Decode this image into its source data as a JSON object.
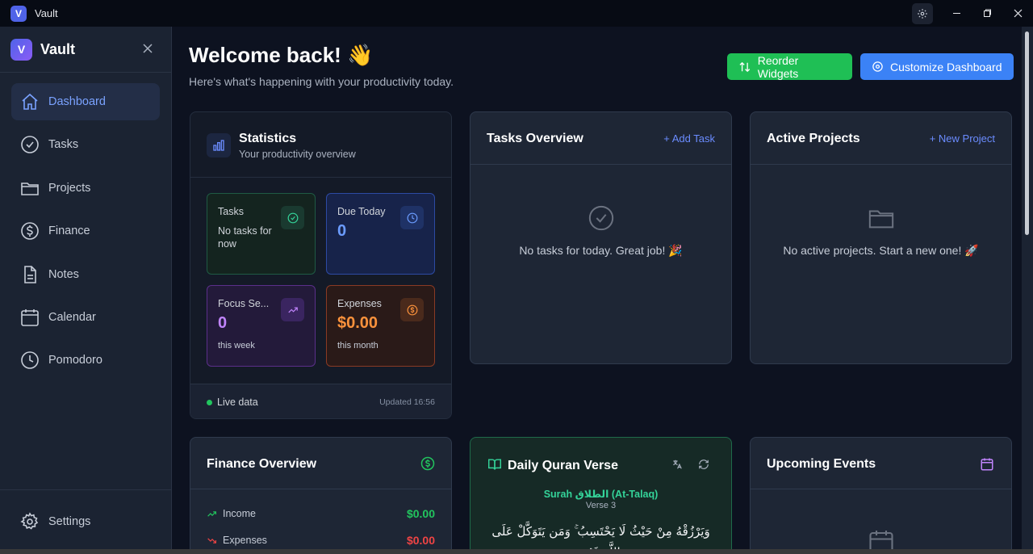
{
  "window": {
    "title": "Vault",
    "logo_letter": "V"
  },
  "sidebar": {
    "brand": "Vault",
    "logo_letter": "V",
    "items": [
      {
        "label": "Dashboard",
        "icon": "home-icon",
        "active": true
      },
      {
        "label": "Tasks",
        "icon": "check-circle-icon"
      },
      {
        "label": "Projects",
        "icon": "folder-icon"
      },
      {
        "label": "Finance",
        "icon": "dollar-circle-icon"
      },
      {
        "label": "Notes",
        "icon": "file-icon"
      },
      {
        "label": "Calendar",
        "icon": "calendar-icon"
      },
      {
        "label": "Pomodoro",
        "icon": "clock-icon"
      }
    ],
    "settings_label": "Settings"
  },
  "header": {
    "title": "Welcome back! 👋",
    "subtitle": "Here's what's happening with your productivity today.",
    "reorder_label": "Reorder Widgets",
    "customize_label": "Customize Dashboard"
  },
  "statistics": {
    "title": "Statistics",
    "subtitle": "Your productivity overview",
    "tiles": {
      "tasks": {
        "label": "Tasks",
        "note": "No tasks for now"
      },
      "due_today": {
        "label": "Due Today",
        "value": "0"
      },
      "focus": {
        "label": "Focus Se...",
        "value": "0",
        "note": "this week"
      },
      "expenses": {
        "label": "Expenses",
        "value": "$0.00",
        "note": "this month"
      }
    },
    "live_label": "Live data",
    "updated": "Updated 16:56"
  },
  "tasks_overview": {
    "title": "Tasks Overview",
    "action": "+ Add Task",
    "empty": "No tasks for today. Great job! 🎉"
  },
  "active_projects": {
    "title": "Active Projects",
    "action": "+ New Project",
    "empty": "No active projects. Start a new one! 🚀"
  },
  "finance_overview": {
    "title": "Finance Overview",
    "income_label": "Income",
    "income_value": "$0.00",
    "expenses_label": "Expenses",
    "expenses_value": "$0.00"
  },
  "quran": {
    "title": "Daily Quran Verse",
    "surah": "Surah الطلاق (At-Talaq)",
    "verse": "Verse 3",
    "arabic": "وَيَرْزُقْهُ مِنْ حَيْثُ لَا يَحْتَسِبُ ۚ وَمَن يَتَوَكَّلْ عَلَى اللَّهِ فَهُوَ"
  },
  "events": {
    "title": "Upcoming Events"
  },
  "colors": {
    "accent_blue": "#3b82f6",
    "accent_green": "#1fbf55",
    "expense_orange": "#f59e0b",
    "focus_purple": "#a855f7",
    "danger_red": "#f04444"
  }
}
